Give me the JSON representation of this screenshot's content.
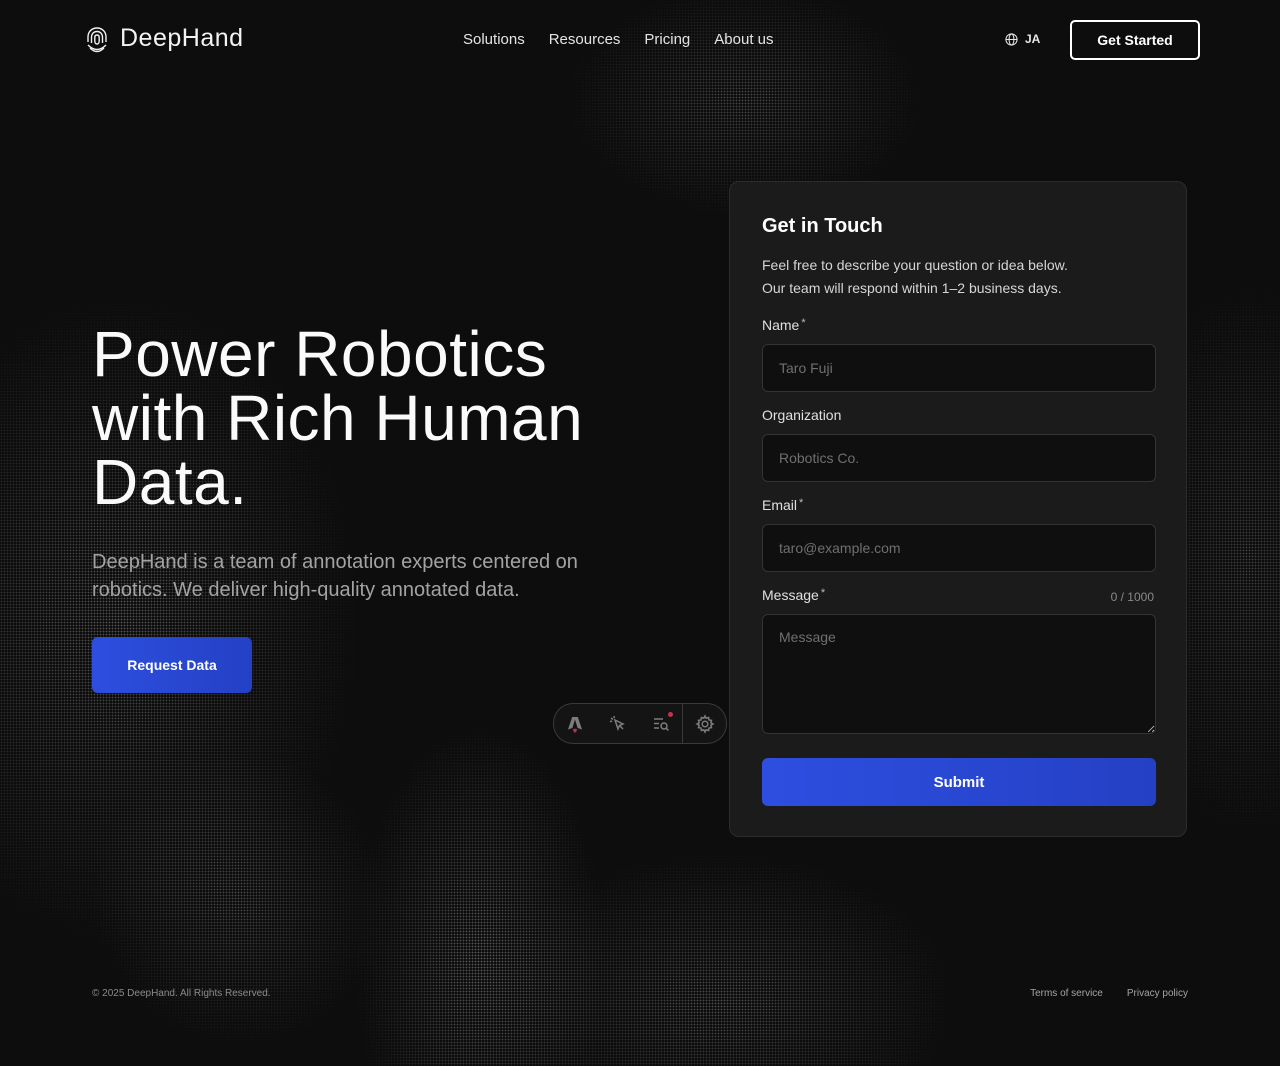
{
  "header": {
    "brand": "DeepHand",
    "nav": [
      "Solutions",
      "Resources",
      "Pricing",
      "About us"
    ],
    "language": "JA",
    "cta_label": "Get Started"
  },
  "hero": {
    "title_lines": [
      "Power Robotics",
      "with Rich Human",
      "Data."
    ],
    "subtitle": "DeepHand is a team of annotation experts centered on robotics. We deliver high-quality annotated data.",
    "cta_label": "Request Data"
  },
  "toolbar": {
    "items": [
      "astro-icon",
      "cursor-inspect-icon",
      "audit-list-icon",
      "settings-gear-icon"
    ],
    "notification_color": "#c0354a"
  },
  "contact_form": {
    "title": "Get in Touch",
    "description_lines": [
      "Feel free to describe your question or idea below.",
      "Our team will respond within 1–2 business days."
    ],
    "required_marker": "*",
    "fields": {
      "name": {
        "label": "Name",
        "placeholder": "Taro Fuji",
        "value": ""
      },
      "organization": {
        "label": "Organization",
        "placeholder": "Robotics Co.",
        "value": ""
      },
      "email": {
        "label": "Email",
        "placeholder": "taro@example.com",
        "value": ""
      },
      "message": {
        "label": "Message",
        "placeholder": "Message",
        "value": "",
        "counter": "0 / 1000"
      }
    },
    "submit_label": "Submit"
  },
  "footer": {
    "copyright": "© 2025 DeepHand. All Rights Reserved.",
    "links": [
      "Terms of service",
      "Privacy policy"
    ]
  },
  "colors": {
    "background": "#0d0d0d",
    "card": "#1b1b1b",
    "accent": "#2d4ee0",
    "input_bg": "#0f0f0f"
  }
}
